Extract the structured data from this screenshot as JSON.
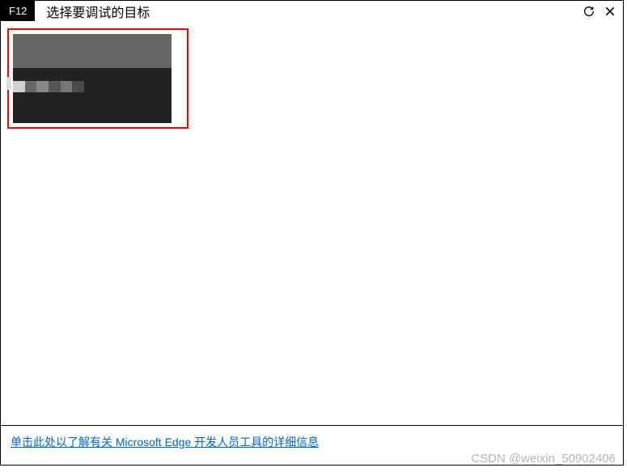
{
  "titlebar": {
    "badge": "F12",
    "title": "选择要调试的目标",
    "refresh_icon": "refresh-icon",
    "close_icon": "close-icon"
  },
  "content": {
    "targets": [
      {
        "name": "debug-target-1"
      }
    ]
  },
  "footer": {
    "link_text": "单击此处以了解有关 Microsoft Edge 开发人员工具的详细信息"
  },
  "watermark": "CSDN @weixin_50902406"
}
